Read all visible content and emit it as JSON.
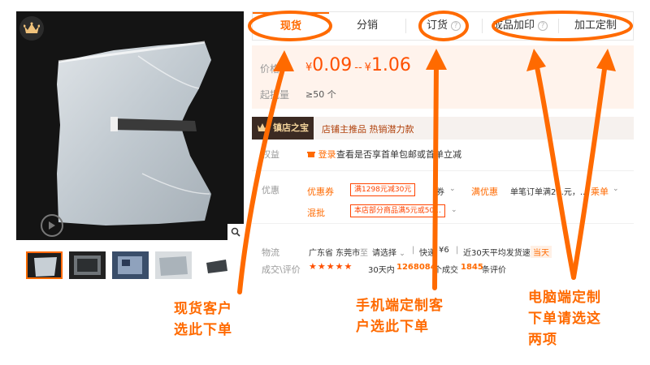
{
  "tabs": {
    "spot": "现货",
    "distribution": "分销",
    "order": "订货",
    "finished_printing": "成品加印",
    "custom_processing": "加工定制"
  },
  "price": {
    "label": "价格",
    "currency": "¥",
    "min": "0.09",
    "separator": "--",
    "max": "1.06",
    "moq_label": "起批量",
    "moq_value": "≥50 个"
  },
  "store_banner": {
    "badge": "镇店之宝",
    "promo": "店铺主推品  热销潜力款"
  },
  "benefits": {
    "label": "权益",
    "login_link": "登录",
    "note": "查看是否享首单包邮或首单立减"
  },
  "discounts": {
    "label": "优惠",
    "coupon": {
      "name": "优惠券",
      "tag": "满1298元减30元",
      "extra": "券",
      "full_reduction": "满优惠",
      "desc": "单笔订单满2...元，...",
      "more": "乘单"
    },
    "mixed": {
      "name": "混批",
      "tag": "本店部分商品满5元或50..."
    }
  },
  "logistics": {
    "label": "物流",
    "origin": "广东省 东莞市",
    "to": "至",
    "select": "请选择",
    "express": "快递",
    "express_price": "¥6",
    "ship_speed_label": "近30天平均发货速度：",
    "ship_speed_value": "当天"
  },
  "reviews": {
    "label": "成交\\评价",
    "stars": "★★★★★",
    "days_label": "30天内",
    "count": "1268084",
    "count_unit": "个成交",
    "reviews_count": "1845",
    "reviews_unit": "条评价"
  },
  "annotations": {
    "spot_line1": "现货客户",
    "spot_line2": "选此下单",
    "mobile_line1": "手机端定制客",
    "mobile_line2": "户选此下单",
    "pc_line1": "电脑端定制",
    "pc_line2": "下单请选这",
    "pc_line3": "两项"
  },
  "colors": {
    "accent": "#ff6a00",
    "price": "#ff5000",
    "price_bg": "#fff3ec"
  }
}
